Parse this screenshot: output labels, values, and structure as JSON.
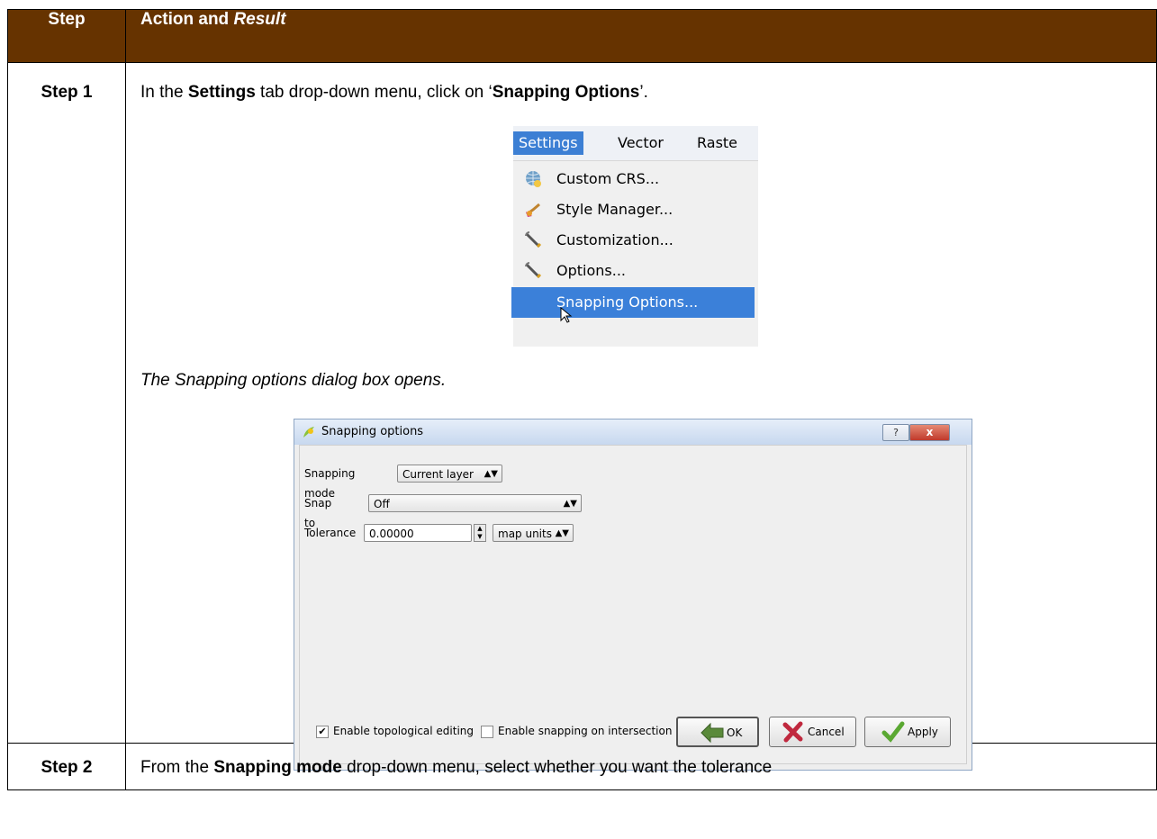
{
  "table": {
    "headers": {
      "step": "Step",
      "action": "Action and ",
      "action_italic": "Result"
    },
    "rows": [
      {
        "step": "Step 1",
        "text_a": "In the ",
        "text_b": "Settings",
        "text_c": " tab drop-down menu, click on ‘",
        "text_d": "Snapping Options",
        "text_e": "’.",
        "result": "The Snapping options dialog box opens"
      },
      {
        "step": "Step 2",
        "text_a": "From the ",
        "text_b": "Snapping mode",
        "text_c": " drop-down menu, select whether you want the tolerance"
      }
    ]
  },
  "menu": {
    "bar": [
      "Settings",
      "Vector",
      "Raste"
    ],
    "items": [
      {
        "label": "Custom CRS...",
        "icon": "globe-icon"
      },
      {
        "label": "Style Manager...",
        "icon": "paintbrush-icon"
      },
      {
        "label": "Customization...",
        "icon": "wrench-icon"
      },
      {
        "label": "Options...",
        "icon": "wrench-icon"
      },
      {
        "label": "Snapping Options...",
        "icon": "none",
        "selected": true
      }
    ]
  },
  "dialog": {
    "title": "Snapping options",
    "help": "?",
    "close": "x",
    "snapping_mode_label": "Snapping mode",
    "snapping_mode_value": "Current layer",
    "snap_to_label": "Snap to",
    "snap_to_value": "Off",
    "tolerance_label": "Tolerance",
    "tolerance_value": "0.00000",
    "tolerance_units": "map units",
    "topological_label": "Enable topological editing",
    "topological_checked": true,
    "intersection_label": "Enable snapping on intersection",
    "intersection_checked": false,
    "ok": "OK",
    "cancel": "Cancel",
    "apply": "Apply"
  },
  "colors": {
    "header_bg": "#663300",
    "menu_highlight": "#3b80d9"
  }
}
